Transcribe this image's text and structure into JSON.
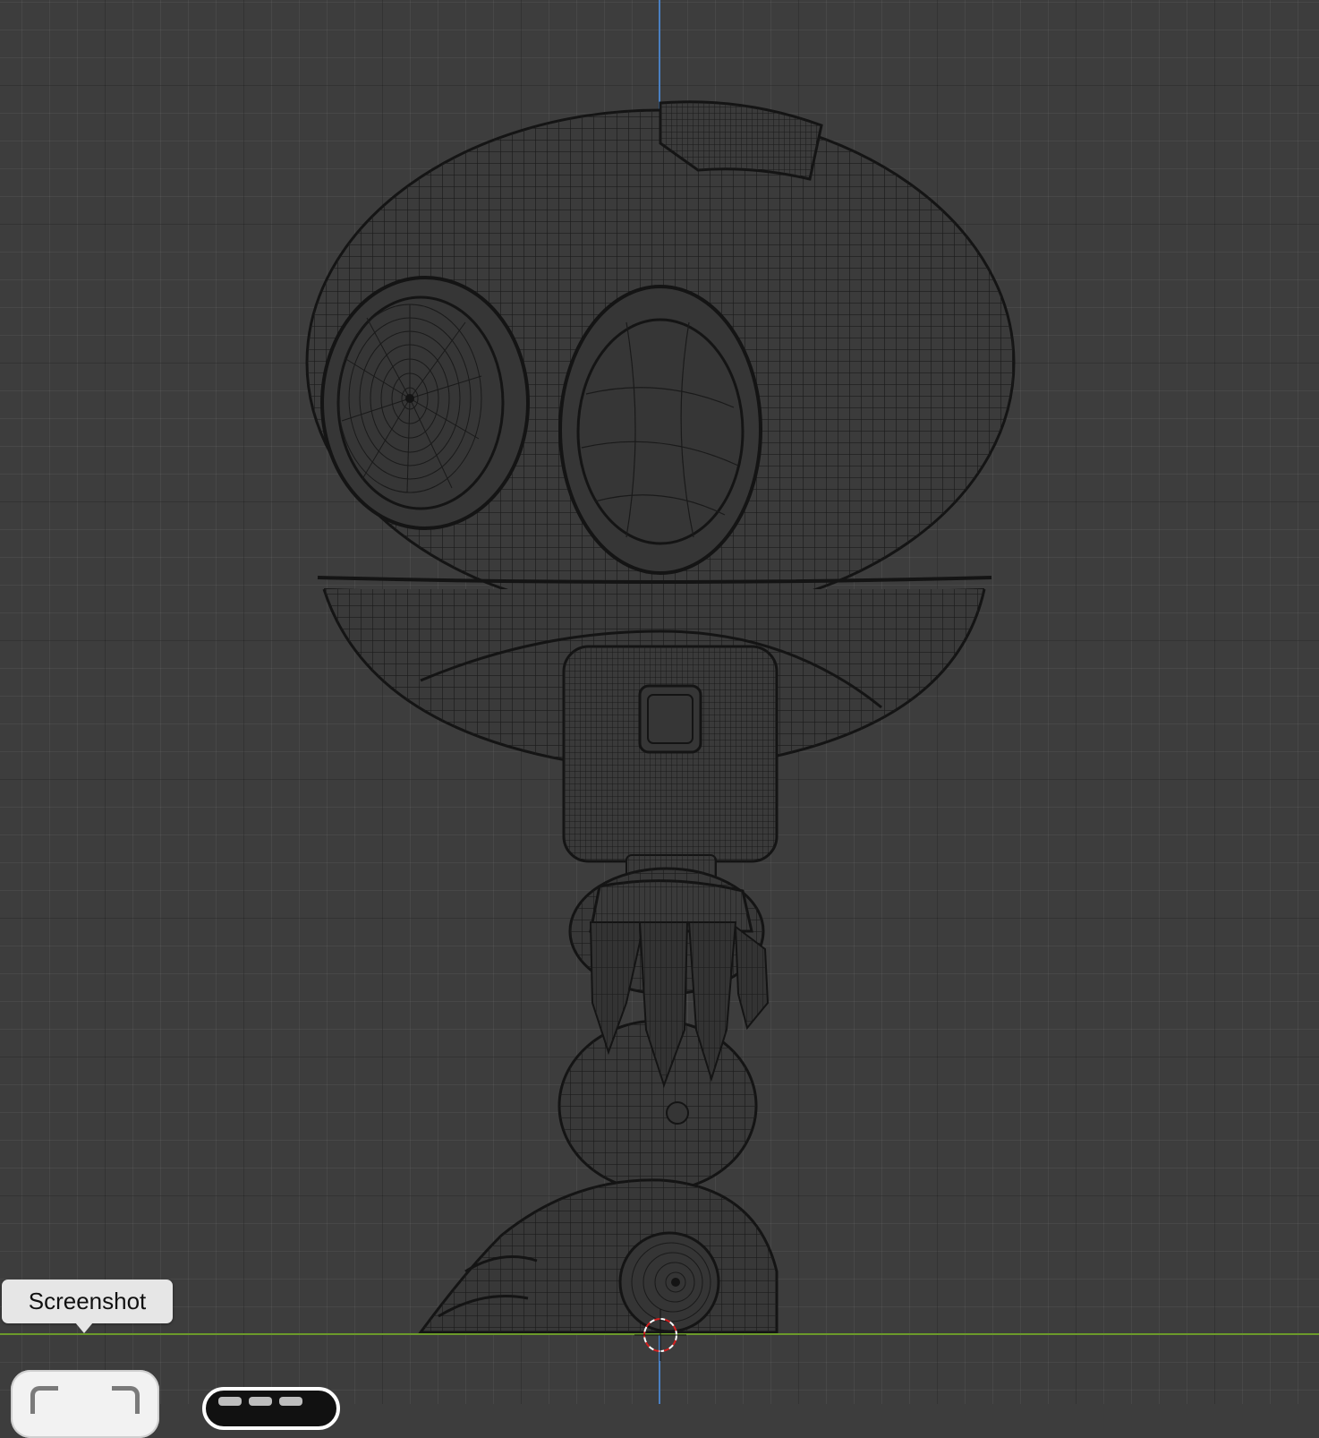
{
  "viewport": {
    "background_color": "#3d3d3d",
    "axis_colors": {
      "vertical_axis": "#4a7fc1",
      "ground_axis": "#6b9a2a"
    },
    "object_name": "robot-wireframe",
    "view": "front-orthographic-wireframe"
  },
  "tooltip": {
    "text": "Screenshot"
  },
  "toolbar": {
    "screenshot_button_icon": "screenshot-frame-icon",
    "thumbnail_icon": "screenshot-thumbnail-icon"
  }
}
